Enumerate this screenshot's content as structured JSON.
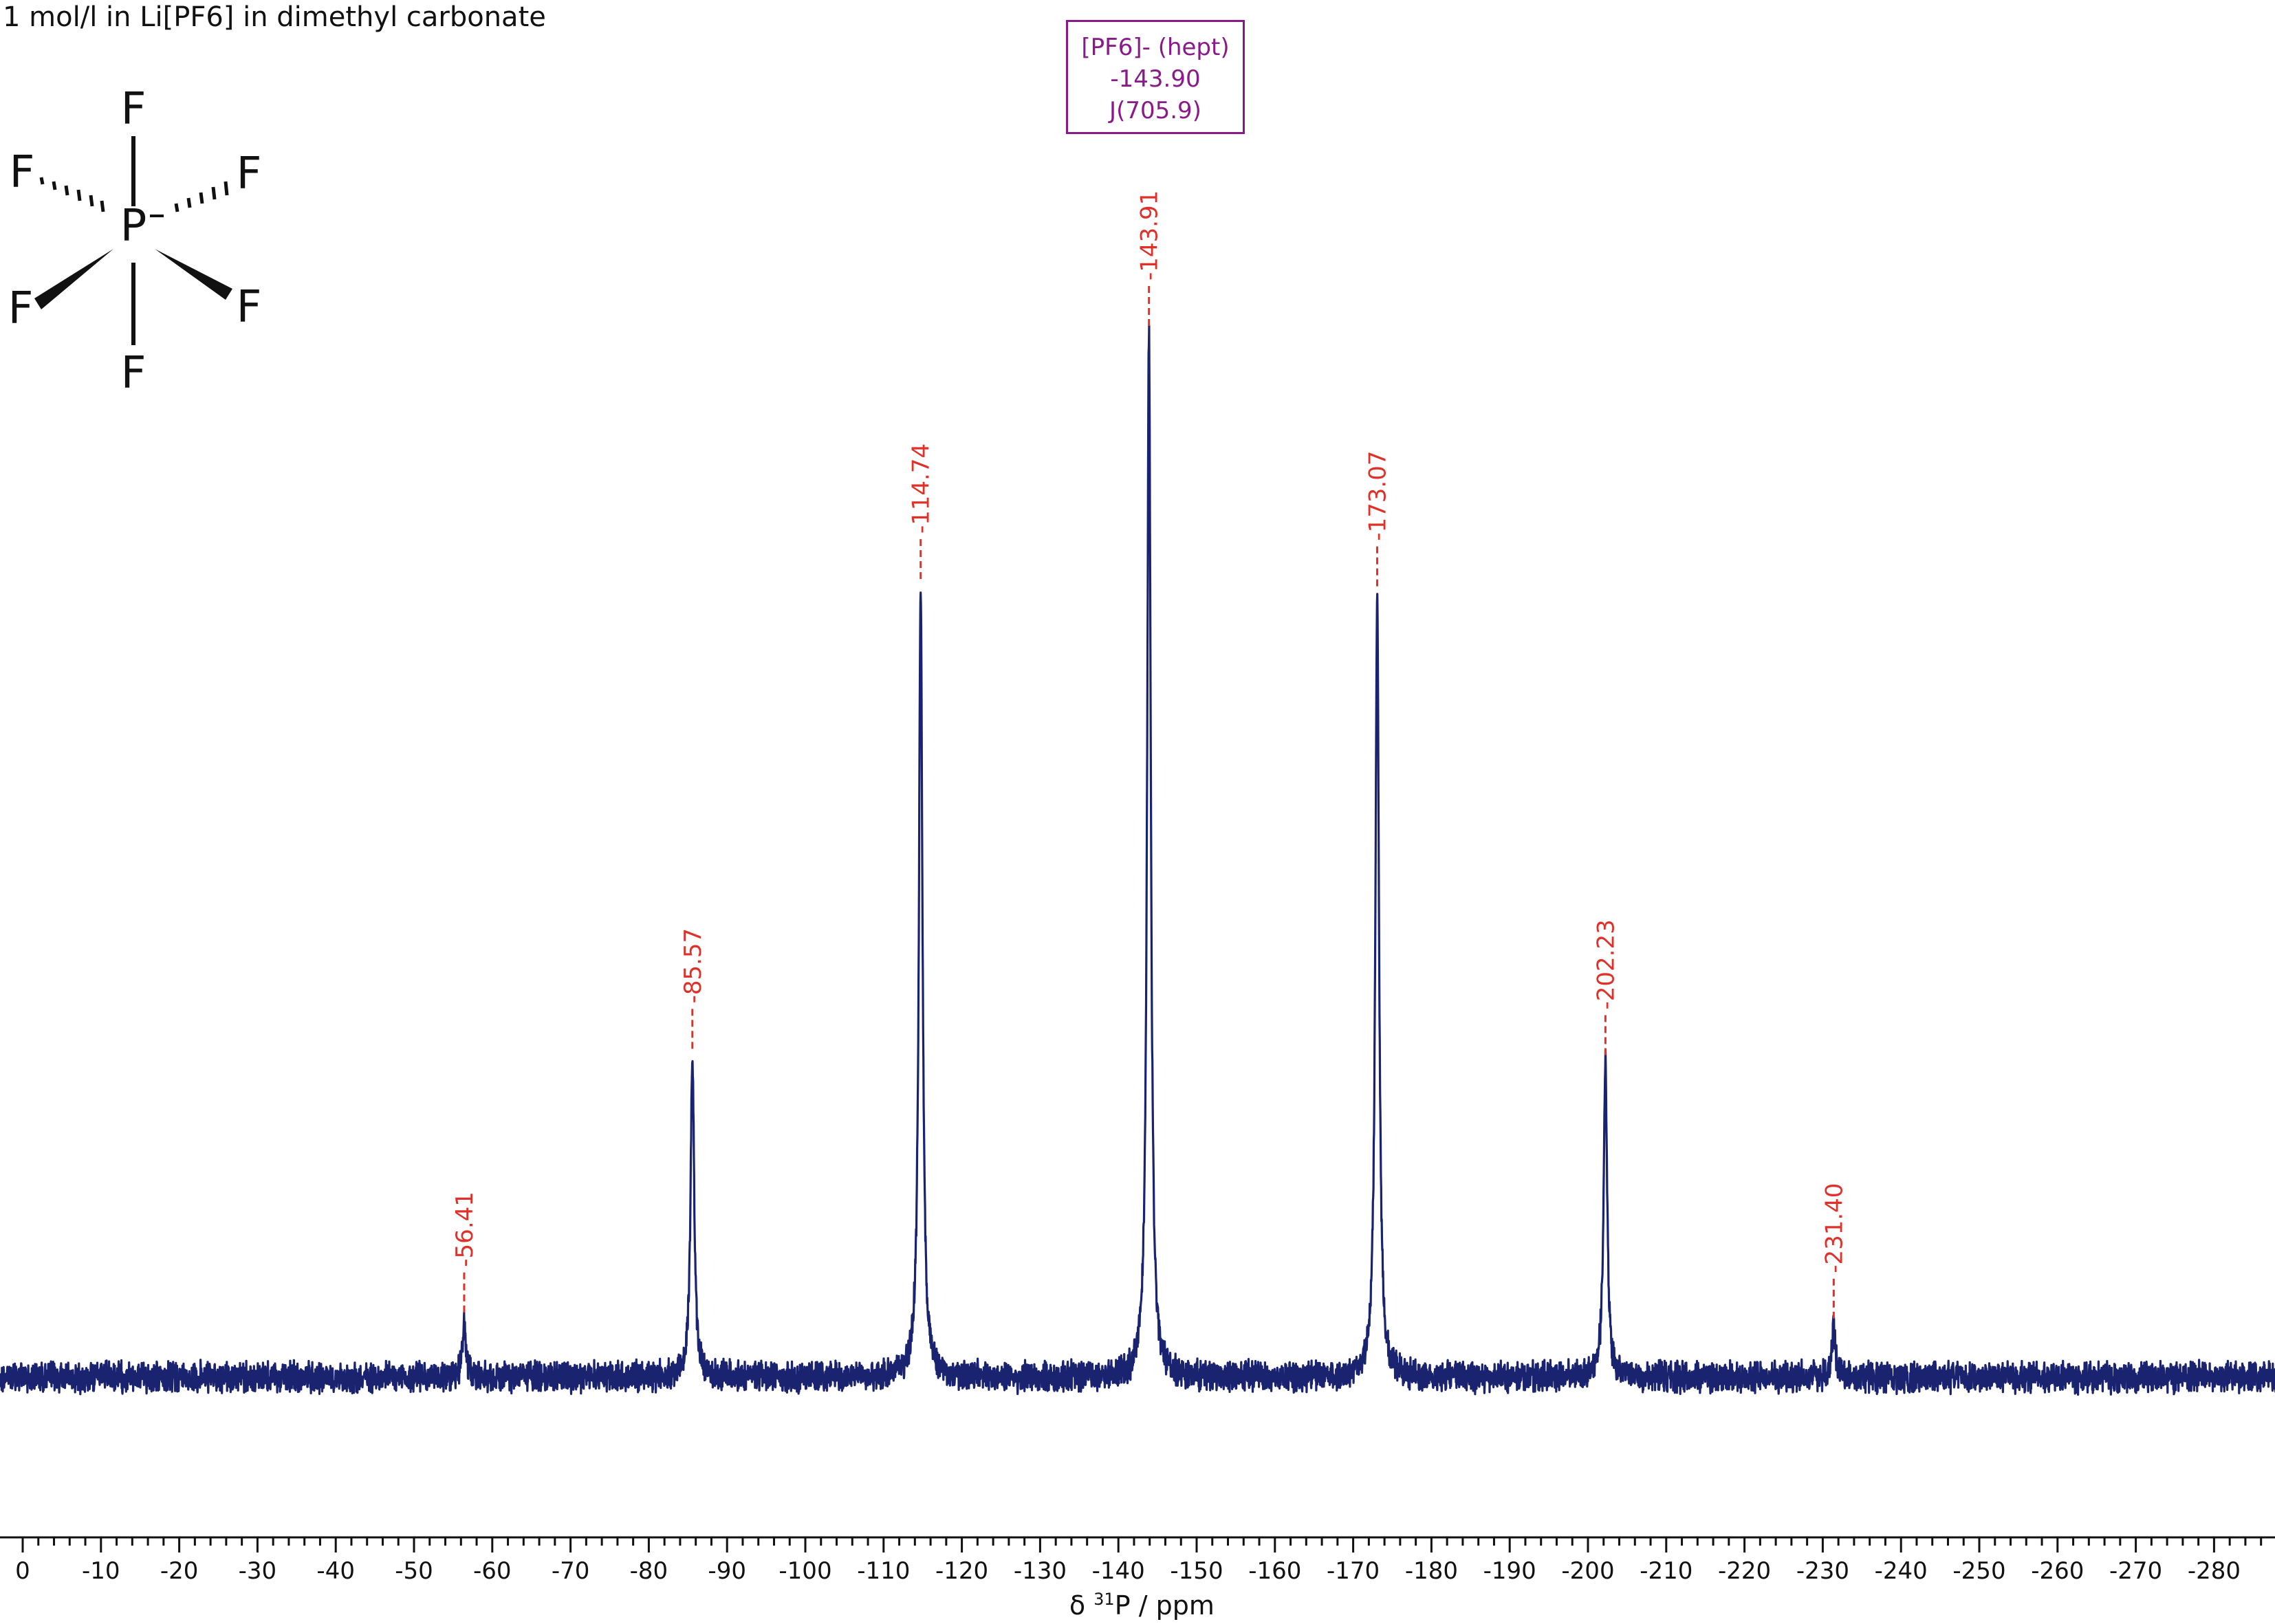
{
  "sample_title": "1 mol/l in Li[PF6] in dimethyl carbonate",
  "multiplet": {
    "label": "[PF6]- (hept)",
    "shift": "-143.90",
    "coupling": "J(705.9)"
  },
  "structure": {
    "central_atom": "P",
    "charge": "−",
    "ligand": "F"
  },
  "colors": {
    "spectrum": "#1a2370",
    "peak_label": "#e0302a",
    "multiplet_box": "#8a1a8a",
    "axis": "#111111"
  },
  "chart_data": {
    "type": "line",
    "title": "1 mol/l in Li[PF6] in dimethyl carbonate",
    "xlabel": "δ 31P / ppm",
    "ylabel": "",
    "xlim": [
      3,
      -288
    ],
    "axis_reversed": true,
    "ticks": [
      0,
      -10,
      -20,
      -30,
      -40,
      -50,
      -60,
      -70,
      -80,
      -90,
      -100,
      -110,
      -120,
      -130,
      -140,
      -150,
      -160,
      -170,
      -180,
      -190,
      -200,
      -210,
      -220,
      -230,
      -240,
      -250,
      -260,
      -270,
      -280
    ],
    "tick_labels": [
      "0",
      "-10",
      "-20",
      "-30",
      "-40",
      "-50",
      "-60",
      "-70",
      "-80",
      "-90",
      "-100",
      "-110",
      "-120",
      "-130",
      "-140",
      "-150",
      "-160",
      "-170",
      "-180",
      "-190",
      "-200",
      "-210",
      "-220",
      "-230",
      "-240",
      "-250",
      "-260",
      "-270",
      "-280"
    ],
    "peaks": [
      {
        "shift": -56.41,
        "label": "-56.41",
        "height": 0.053
      },
      {
        "shift": -85.57,
        "label": "-85.57",
        "height": 0.306
      },
      {
        "shift": -114.74,
        "label": "-114.74",
        "height": 0.757
      },
      {
        "shift": -143.91,
        "label": "-143.91",
        "height": 1.0
      },
      {
        "shift": -173.07,
        "label": "-173.07",
        "height": 0.75
      },
      {
        "shift": -202.23,
        "label": "-202.23",
        "height": 0.3
      },
      {
        "shift": -231.4,
        "label": "-231.40",
        "height": 0.047
      }
    ]
  }
}
